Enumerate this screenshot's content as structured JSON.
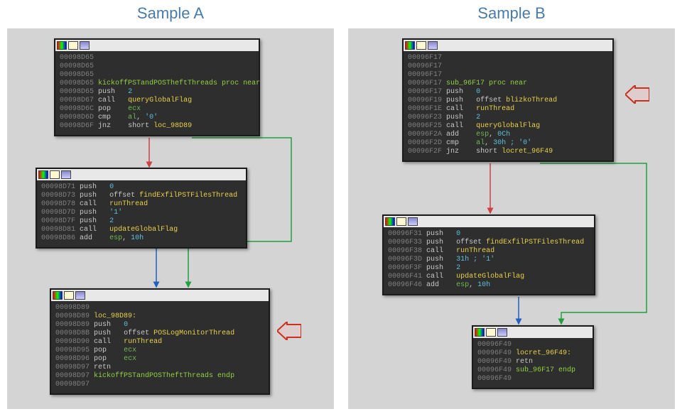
{
  "samples": [
    {
      "title": "Sample A",
      "blocks": [
        {
          "lines": [
            {
              "addr": "00098D65",
              "rest": ""
            },
            {
              "addr": "00098D65",
              "rest": ""
            },
            {
              "addr": "00098D65",
              "rest": ""
            },
            {
              "addr": "00098D65",
              "proc": "kickoffPSTandPOSTheftThreads proc near"
            },
            {
              "addr": "00098D65",
              "instr": "push",
              "num": "2"
            },
            {
              "addr": "00098D67",
              "instr": "call",
              "func": "queryGlobalFlag"
            },
            {
              "addr": "00098D6C",
              "instr": "pop",
              "reg": "ecx"
            },
            {
              "addr": "00098D6D",
              "instr": "cmp",
              "regop": "al, '0'"
            },
            {
              "addr": "00098D6F",
              "instr": "jnz",
              "target": "short loc_98D89"
            }
          ]
        },
        {
          "lines": [
            {
              "addr": "00098D71",
              "instr": "push",
              "num": "0"
            },
            {
              "addr": "00098D73",
              "instr": "push",
              "offset": "offset",
              "func": "findExfilPSTFilesThread"
            },
            {
              "addr": "00098D78",
              "instr": "call",
              "func": "runThread"
            },
            {
              "addr": "00098D7D",
              "instr": "push",
              "str": "'1'"
            },
            {
              "addr": "00098D7F",
              "instr": "push",
              "num": "2"
            },
            {
              "addr": "00098D81",
              "instr": "call",
              "func": "updateGlobalFlag"
            },
            {
              "addr": "00098D86",
              "instr": "add",
              "regop": "esp, 10h"
            }
          ]
        },
        {
          "lines": [
            {
              "addr": "00098D89",
              "rest": ""
            },
            {
              "addr": "00098D89",
              "label": "loc_98D89:"
            },
            {
              "addr": "00098D89",
              "instr": "push",
              "num": "0"
            },
            {
              "addr": "00098D8B",
              "instr": "push",
              "offset": "offset",
              "func": "POSLogMonitorThread"
            },
            {
              "addr": "00098D90",
              "instr": "call",
              "func": "runThread"
            },
            {
              "addr": "00098D95",
              "instr": "pop",
              "reg": "ecx"
            },
            {
              "addr": "00098D96",
              "instr": "pop",
              "reg": "ecx"
            },
            {
              "addr": "00098D97",
              "instr": "retn"
            },
            {
              "addr": "00098D97",
              "proc": "kickoffPSTandPOSTheftThreads endp"
            },
            {
              "addr": "00098D97",
              "rest": ""
            }
          ]
        }
      ]
    },
    {
      "title": "Sample B",
      "blocks": [
        {
          "lines": [
            {
              "addr": "00096F17",
              "rest": ""
            },
            {
              "addr": "00096F17",
              "rest": ""
            },
            {
              "addr": "00096F17",
              "rest": ""
            },
            {
              "addr": "00096F17",
              "proc": "sub_96F17 proc near"
            },
            {
              "addr": "00096F17",
              "instr": "push",
              "num": "0"
            },
            {
              "addr": "00096F19",
              "instr": "push",
              "offset": "offset",
              "func": "blizkoThread"
            },
            {
              "addr": "00096F1E",
              "instr": "call",
              "func": "runThread"
            },
            {
              "addr": "00096F23",
              "instr": "push",
              "num": "2"
            },
            {
              "addr": "00096F25",
              "instr": "call",
              "func": "queryGlobalFlag"
            },
            {
              "addr": "00096F2A",
              "instr": "add",
              "regop": "esp, 0Ch"
            },
            {
              "addr": "00096F2D",
              "instr": "cmp",
              "regop": "al, 30h ; '0'"
            },
            {
              "addr": "00096F2F",
              "instr": "jnz",
              "target": "short locret_96F49"
            }
          ]
        },
        {
          "lines": [
            {
              "addr": "00096F31",
              "instr": "push",
              "num": "0"
            },
            {
              "addr": "00096F33",
              "instr": "push",
              "offset": "offset",
              "func": "findExfilPSTFilesThread"
            },
            {
              "addr": "00096F38",
              "instr": "call",
              "func": "runThread"
            },
            {
              "addr": "00096F3D",
              "instr": "push",
              "str": "31h ; '1'"
            },
            {
              "addr": "00096F3F",
              "instr": "push",
              "num": "2"
            },
            {
              "addr": "00096F41",
              "instr": "call",
              "func": "updateGlobalFlag"
            },
            {
              "addr": "00096F46",
              "instr": "add",
              "regop": "esp, 10h"
            }
          ]
        },
        {
          "lines": [
            {
              "addr": "00096F49",
              "rest": ""
            },
            {
              "addr": "00096F49",
              "label": "locret_96F49:"
            },
            {
              "addr": "00096F49",
              "instr": "retn"
            },
            {
              "addr": "00096F49",
              "proc": "sub_96F17 endp"
            },
            {
              "addr": "00096F49",
              "rest": ""
            }
          ]
        }
      ]
    }
  ]
}
